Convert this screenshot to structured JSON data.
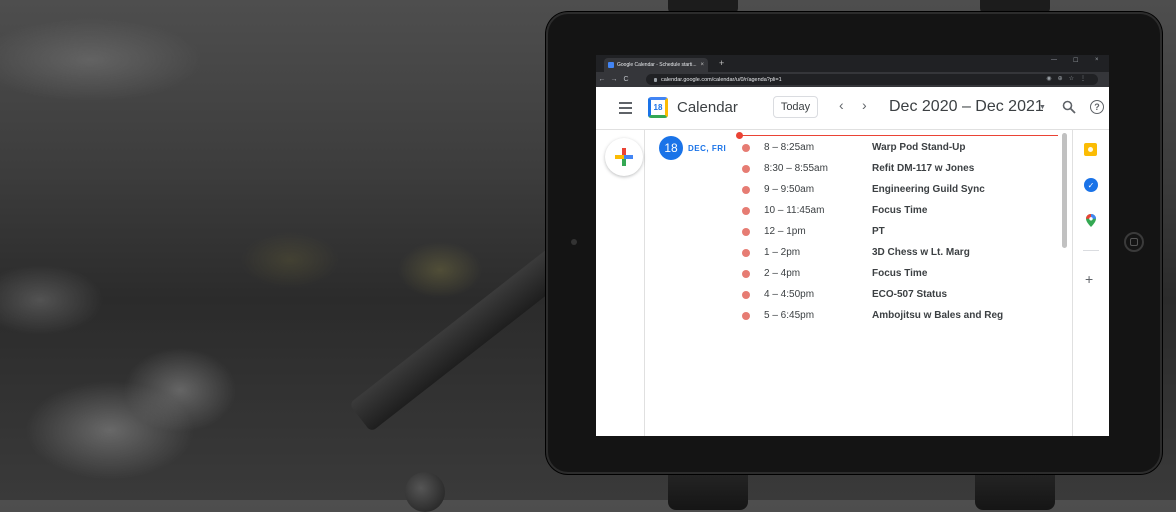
{
  "browser": {
    "tab_title": "Google Calendar - Schedule starti...",
    "tab_close": "×",
    "new_tab": "+",
    "url": "calendar.google.com/calendar/u/0/r/agenda?pli=1",
    "nav_back": "←",
    "nav_forward": "→",
    "nav_reload": "C",
    "win_minimize": "—",
    "win_maximize": "☐",
    "win_close": "×"
  },
  "header": {
    "app_name": "Calendar",
    "logo_number": "18",
    "today_label": "Today",
    "prev_glyph": "‹",
    "next_glyph": "›",
    "date_range": "Dec 2020 – Dec 2021",
    "range_caret": "▼",
    "help_glyph": "?"
  },
  "agenda": {
    "day_number": "18",
    "day_label": "DEC, FRI",
    "events": [
      {
        "time": "8 – 8:25am",
        "title": "Warp Pod Stand-Up"
      },
      {
        "time": "8:30 – 8:55am",
        "title": "Refit DM-117 w Jones"
      },
      {
        "time": "9 – 9:50am",
        "title": "Engineering Guild Sync"
      },
      {
        "time": "10 – 11:45am",
        "title": "Focus Time"
      },
      {
        "time": "12 – 1pm",
        "title": "PT"
      },
      {
        "time": "1 – 2pm",
        "title": "3D Chess w Lt. Marg"
      },
      {
        "time": "2 – 4pm",
        "title": "Focus Time"
      },
      {
        "time": "4 – 4:50pm",
        "title": "ECO-507 Status"
      },
      {
        "time": "5 – 6:45pm",
        "title": "Ambojitsu w Bales and Reg"
      }
    ]
  },
  "side_panel": {
    "icons": [
      "keep-icon",
      "tasks-icon",
      "maps-icon",
      "add-icon"
    ],
    "tasks_glyph": "✓",
    "add_glyph": "+"
  },
  "colors": {
    "accent": "#1a73e8",
    "event_dot": "#e67c73",
    "now_line": "#ea4335"
  }
}
